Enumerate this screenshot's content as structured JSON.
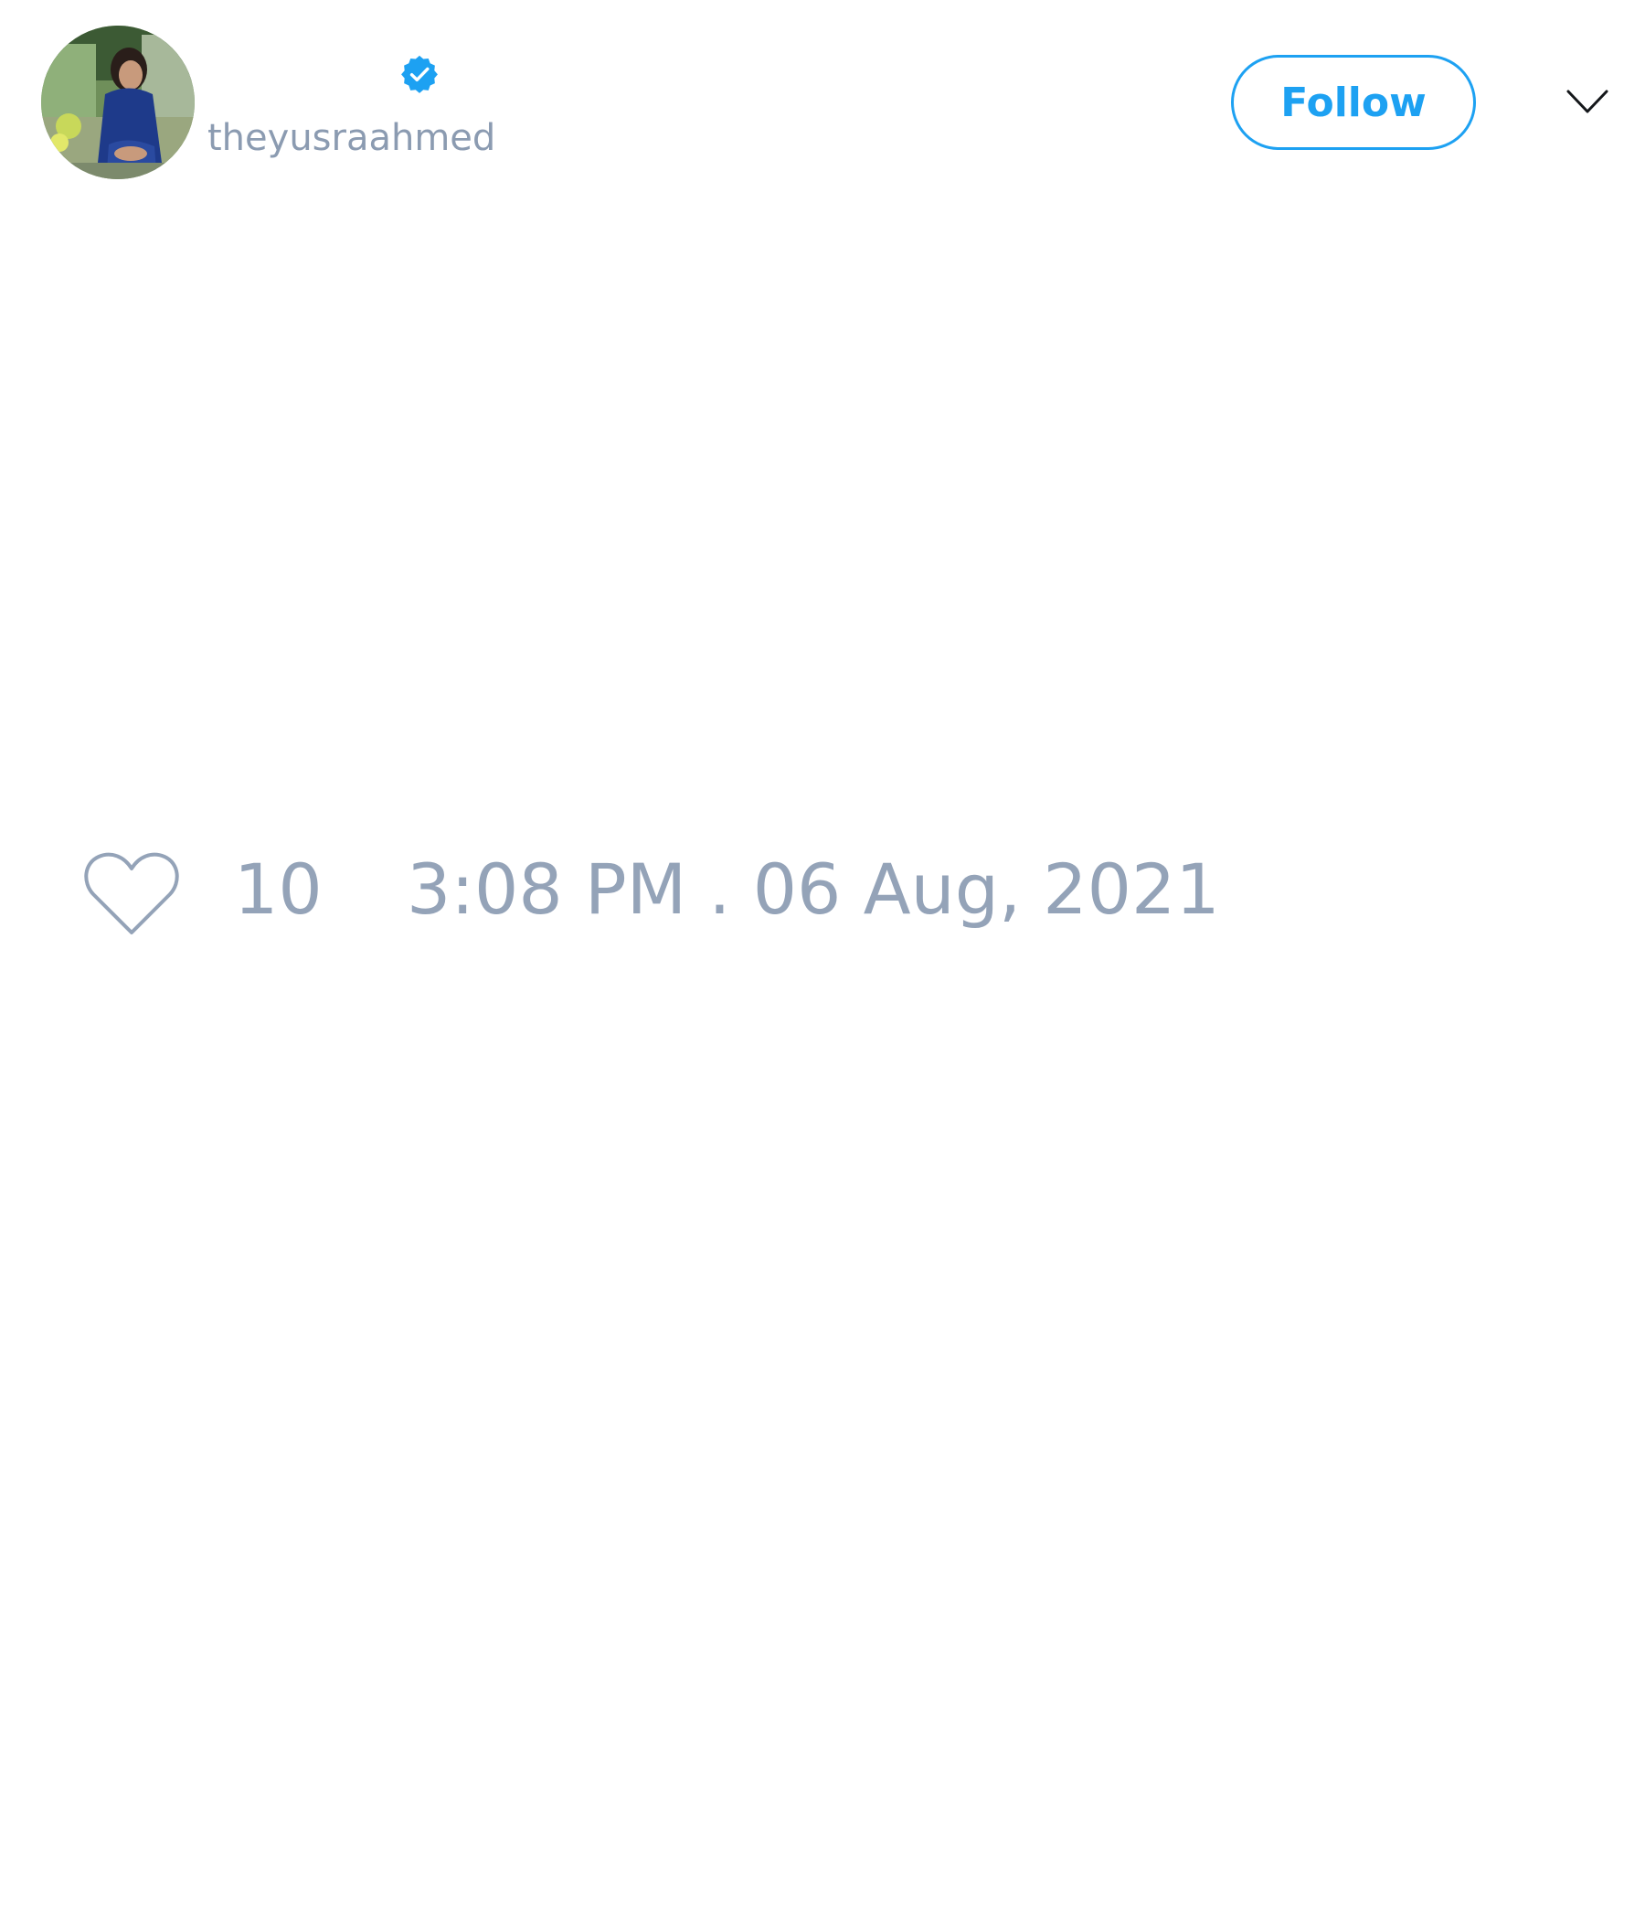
{
  "tweet": {
    "author": {
      "handle": "theyusraahmed",
      "verified": true,
      "avatar_icon": "profile-photo"
    },
    "follow_label": "Follow",
    "menu_icon": "chevron-down-icon",
    "like_icon": "heart-icon",
    "like_count": "10",
    "timestamp": "3:08 PM . 06 Aug, 2021"
  },
  "colors": {
    "accent": "#1da1f2",
    "muted_text": "#94a3b8",
    "background": "#ffffff"
  }
}
